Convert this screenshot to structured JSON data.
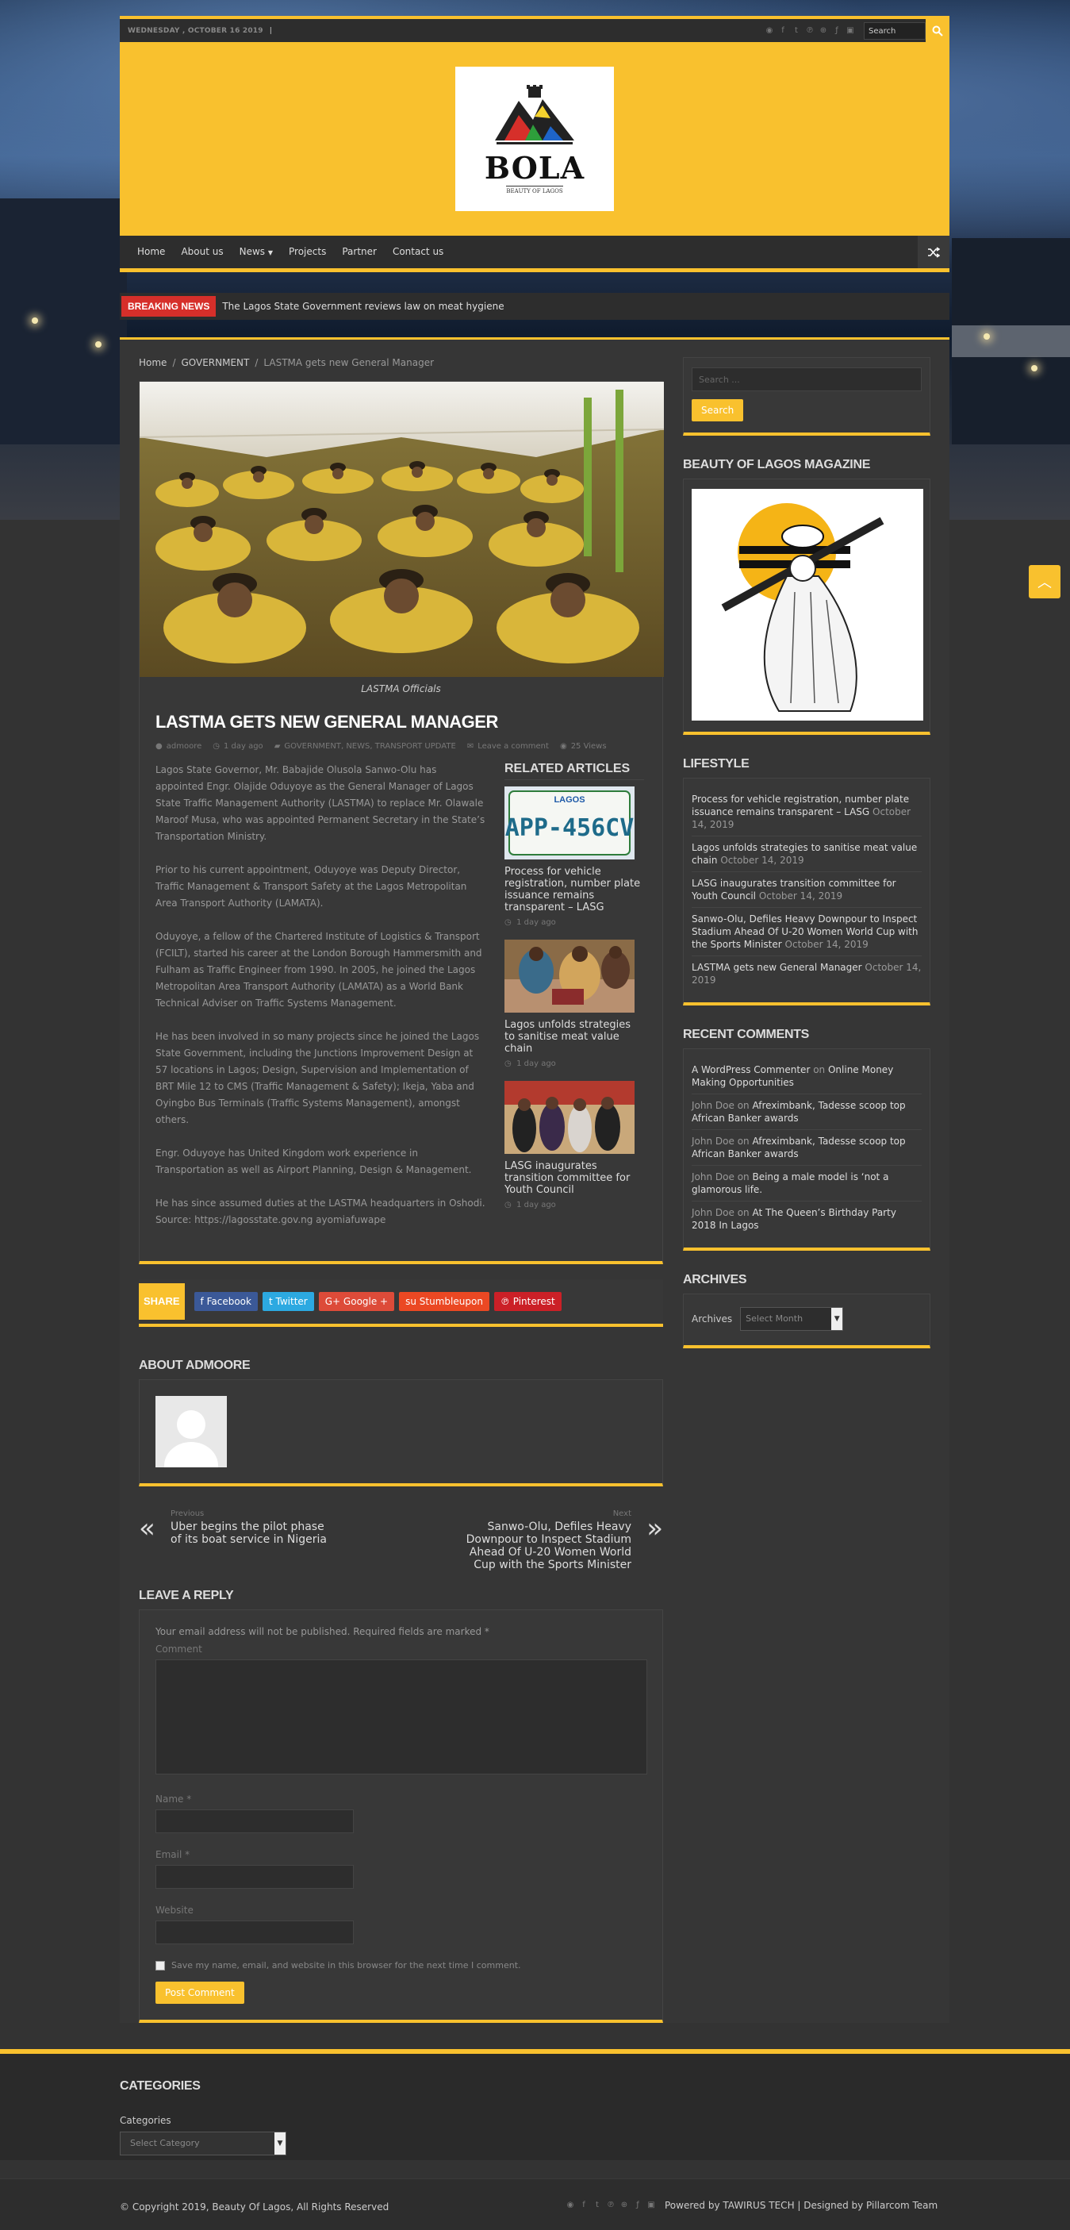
{
  "topbar": {
    "date": "WEDNESDAY , OCTOBER 16 2019",
    "search_placeholder": "Search",
    "social_icons": [
      "rss-icon",
      "facebook-icon",
      "twitter-icon",
      "pinterest-icon",
      "dribbble-icon",
      "foursquare-icon",
      "instagram-icon"
    ]
  },
  "header": {
    "logo_title": "BOLA",
    "logo_subtitle": "BEAUTY OF LAGOS",
    "brand_color": "#f9c12e"
  },
  "nav": {
    "items": [
      "Home",
      "About us",
      "News",
      "Projects",
      "Partner",
      "Contact us"
    ]
  },
  "breaking": {
    "label": "BREAKING NEWS",
    "text": "The Lagos State Government reviews law on meat hygiene"
  },
  "breadcrumb": {
    "home": "Home",
    "category": "GOVERNMENT",
    "current": "LASTMA gets new General Manager"
  },
  "post": {
    "caption": "LASTMA Officials",
    "title": "LASTMA GETS NEW GENERAL MANAGER",
    "author": "admoore",
    "time": "1 day ago",
    "categories": "GOVERNMENT, NEWS, TRANSPORT UPDATE",
    "comments": "Leave a comment",
    "views": "25 Views",
    "paragraphs": [
      "Lagos State Governor, Mr. Babajide Olusola Sanwo-Olu has appointed Engr. Olajide Oduyoye as the General Manager of Lagos State Traffic Management Authority (LASTMA) to replace Mr. Olawale Maroof Musa, who was appointed Permanent Secretary in the State’s Transportation Ministry.",
      "Prior to his current appointment, Oduyoye was Deputy Director, Traffic Management & Transport Safety at the Lagos Metropolitan Area Transport Authority (LAMATA).",
      "Oduyoye, a fellow of the Chartered Institute of Logistics & Transport (FCILT), started his career at the London Borough Hammersmith and Fulham as Traffic Engineer from 1990. In 2005, he joined the Lagos Metropolitan Area Transport Authority (LAMATA) as a World Bank Technical Adviser on Traffic Systems Management.",
      "He has been involved in so many projects since he joined the Lagos State Government, including the Junctions Improvement Design at 57 locations in Lagos; Design, Supervision and Implementation of BRT Mile 12 to CMS (Traffic Management & Safety); Ikeja, Yaba and Oyingbo Bus Terminals (Traffic Systems Management), amongst others.",
      "Engr. Oduyoye has United Kingdom work experience in Transportation as well as Airport Planning, Design & Management.",
      "He has since assumed duties at the LASTMA headquarters in Oshodi. Source: https://lagosstate.gov.ng ayomiafuwape"
    ]
  },
  "related": {
    "title": "RELATED ARTICLES",
    "items": [
      {
        "title": "Process for vehicle registration, number plate issuance remains transparent – LASG",
        "time": "1 day ago",
        "plate": "APP-456CV",
        "plate_top": "LAGOS"
      },
      {
        "title": "Lagos unfolds strategies to sanitise meat value chain",
        "time": "1 day ago"
      },
      {
        "title": "LASG inaugurates transition committee for Youth Council",
        "time": "1 day ago"
      }
    ]
  },
  "share": {
    "label": "SHARE",
    "buttons": [
      {
        "label": "Facebook",
        "color": "#3b5998",
        "icon": "f"
      },
      {
        "label": "Twitter",
        "color": "#2ca9e1",
        "icon": "t"
      },
      {
        "label": "Google +",
        "color": "#dd4b39",
        "icon": "G+"
      },
      {
        "label": "Stumbleupon",
        "color": "#eb4823",
        "icon": "su"
      },
      {
        "label": "Pinterest",
        "color": "#cb2027",
        "icon": "p"
      }
    ]
  },
  "about": {
    "title": "ABOUT ADMOORE"
  },
  "postnav": {
    "prev_label": "Previous",
    "prev_title": "Uber begins the pilot phase of its boat service in Nigeria",
    "next_label": "Next",
    "next_title": "Sanwo-Olu, Defiles Heavy Downpour to Inspect Stadium Ahead Of U-20 Women World Cup with the Sports Minister"
  },
  "reply": {
    "title": "LEAVE A REPLY",
    "note": "Your email address will not be published. Required fields are marked *",
    "comment_label": "Comment",
    "name_label": "Name *",
    "email_label": "Email *",
    "website_label": "Website",
    "save_label": "Save my name, email, and website in this browser for the next time I comment.",
    "submit": "Post Comment"
  },
  "sidebar": {
    "search_placeholder": "Search ...",
    "search_button": "Search",
    "magazine_title": "BEAUTY OF LAGOS MAGAZINE",
    "lifestyle_title": "LIFESTYLE",
    "lifestyle": [
      {
        "title": "Process for vehicle registration, number plate issuance remains transparent – LASG",
        "date": "October 14, 2019"
      },
      {
        "title": "Lagos unfolds strategies to sanitise meat value chain",
        "date": "October 14, 2019"
      },
      {
        "title": "LASG inaugurates transition committee for Youth Council",
        "date": "October 14, 2019"
      },
      {
        "title": "Sanwo-Olu, Defiles Heavy Downpour to Inspect Stadium Ahead Of U-20 Women World Cup with the Sports Minister",
        "date": "October 14, 2019"
      },
      {
        "title": "LASTMA gets new General Manager",
        "date": "October 14, 2019"
      }
    ],
    "comments_title": "RECENT COMMENTS",
    "comments": [
      {
        "author": "A WordPress Commenter",
        "on": "on",
        "post": "Online Money Making Opportunities"
      },
      {
        "author": "John Doe",
        "on": "on",
        "post": "Afreximbank, Tadesse scoop top African Banker awards"
      },
      {
        "author": "John Doe",
        "on": "on",
        "post": "Afreximbank, Tadesse scoop top African Banker awards"
      },
      {
        "author": "John Doe",
        "on": "on",
        "post": "Being a male model is ‘not a glamorous life."
      },
      {
        "author": "John Doe",
        "on": "on",
        "post": "At The Queen’s Birthday Party 2018 In Lagos"
      }
    ],
    "archives_title": "ARCHIVES",
    "archives_label": "Archives",
    "archives_select": "Select Month"
  },
  "footer": {
    "categories_title": "CATEGORIES",
    "categories_label": "Categories",
    "categories_select": "Select Category",
    "copyright": "© Copyright 2019, Beauty Of Lagos, All Rights Reserved",
    "credits": "Powered by TAWIRUS TECH | Designed by Pillarcom Team"
  }
}
